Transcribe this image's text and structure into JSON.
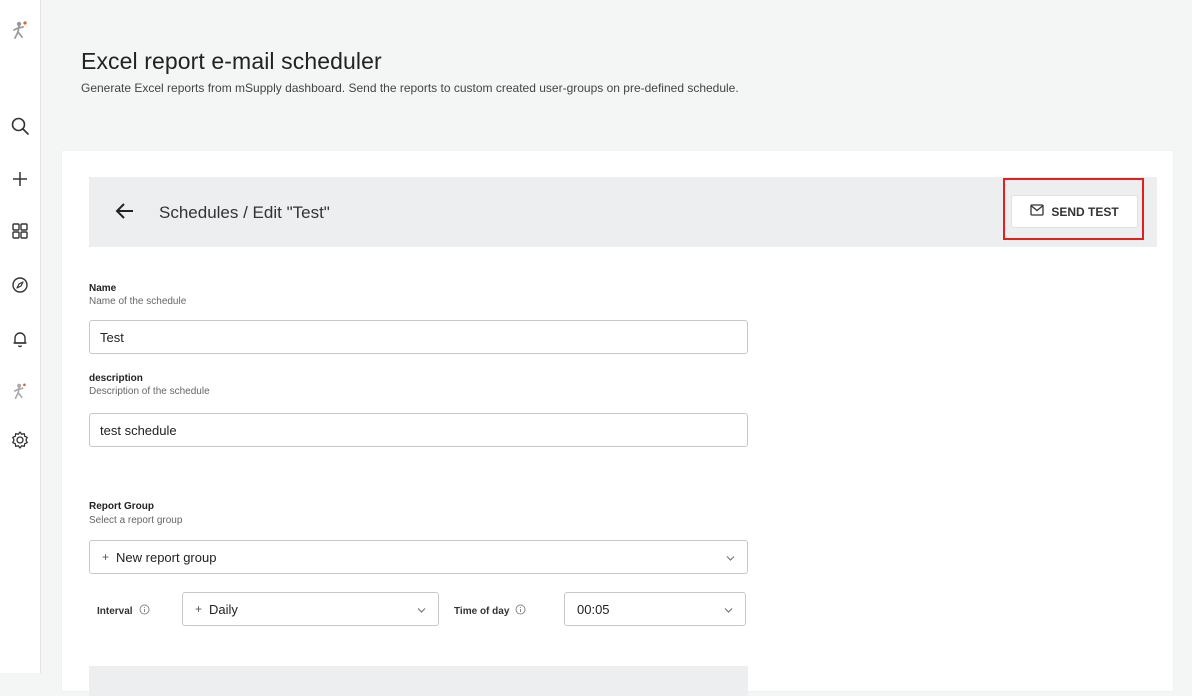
{
  "sidebar": {
    "icons": [
      "logo-icon",
      "search-icon",
      "plus-icon",
      "dashboards-icon",
      "explore-icon",
      "alerts-icon",
      "app-logo-icon",
      "settings-icon"
    ]
  },
  "header": {
    "title": "Excel report e-mail scheduler",
    "subtitle": "Generate Excel reports from mSupply dashboard. Send the reports to custom created user-groups on pre-defined schedule."
  },
  "topbar": {
    "breadcrumb": "Schedules / Edit \"Test\"",
    "send_test_label": "SEND TEST"
  },
  "form": {
    "name": {
      "label": "Name",
      "help": "Name of the schedule",
      "value": "Test"
    },
    "description": {
      "label": "description",
      "help": "Description of the schedule",
      "value": "test schedule"
    },
    "report_group": {
      "label": "Report Group",
      "help": "Select a report group",
      "value": "New report group"
    },
    "interval": {
      "label": "Interval",
      "value": "Daily"
    },
    "time_of_day": {
      "label": "Time of day",
      "value": "00:05"
    }
  },
  "colors": {
    "highlight": "#e3201b",
    "logo_accent": "#e85d2a"
  }
}
